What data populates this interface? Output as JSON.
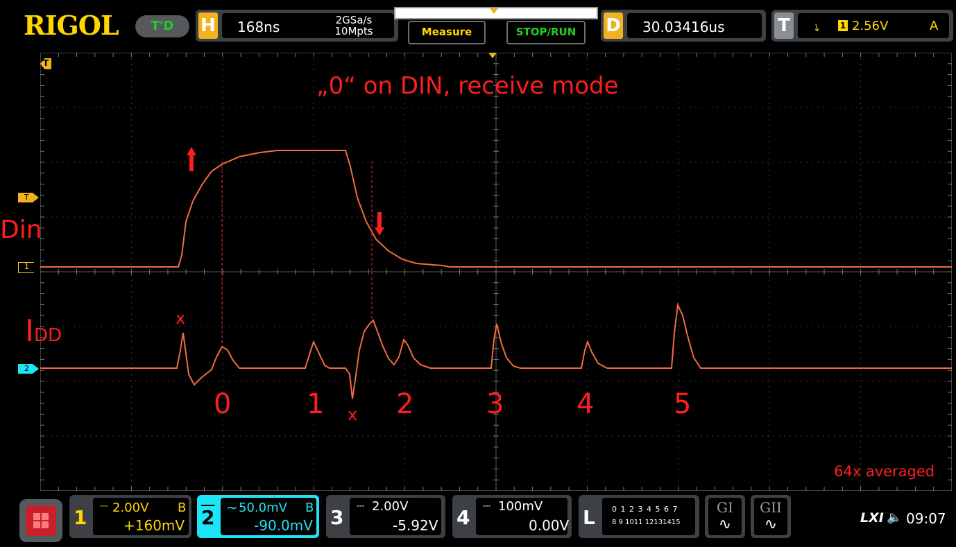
{
  "header": {
    "brand": "RIGOL",
    "trigger_state": "T'D",
    "horizontal": {
      "key": "H",
      "timebase": "168ns",
      "sample_rate": "2GSa/s",
      "memory_depth": "10Mpts"
    },
    "buttons": {
      "measure": "Measure",
      "stop_run": "STOP/RUN"
    },
    "delay": {
      "key": "D",
      "value": "30.03416us"
    },
    "trigger": {
      "key": "T",
      "source_icon": "1",
      "level": "2.56V",
      "mode": "A"
    }
  },
  "screen": {
    "annotations": {
      "title": "„0“ on DIN, receive mode",
      "din_label": "Din",
      "idd_label_main": "I",
      "idd_label_sub": "DD",
      "marker_x1": "x",
      "marker_x2": "x",
      "pulse_numbers": [
        "0",
        "1",
        "2",
        "3",
        "4",
        "5"
      ],
      "averaged": "64x averaged"
    },
    "markers": {
      "ch1": "1",
      "ch2": "2",
      "trigger_level": "T",
      "trigger_pos": "T"
    }
  },
  "channels": [
    {
      "num": "1",
      "coupling_icon": "dc",
      "scale": "2.00V",
      "bw": "B",
      "offset": "+160mV",
      "color": "#ffd700"
    },
    {
      "num": "2",
      "coupling_icon": "ac",
      "scale": "50.0mV",
      "bw": "B",
      "offset": "-90.0mV",
      "color": "#1ee5f5"
    },
    {
      "num": "3",
      "coupling_icon": "dc",
      "scale": "2.00V",
      "bw": "",
      "offset": "-5.92V",
      "color": "#ffffff"
    },
    {
      "num": "4",
      "coupling_icon": "dc",
      "scale": "100mV",
      "bw": "",
      "offset": "0.00V",
      "color": "#ffffff"
    }
  ],
  "logic": {
    "key": "L",
    "row1": "0 1 2 3  4 5 6 7",
    "row2": "8 9 1011 12131415"
  },
  "gen": [
    {
      "label": "GI"
    },
    {
      "label": "GII"
    }
  ],
  "status": {
    "lxi": "LXI",
    "time": "09:07"
  },
  "colors": {
    "ch1": "#ffd700",
    "ch2": "#1ee5f5",
    "annotation": "#ff1e1e",
    "panel": "#3d4145",
    "trace": "#f26d3d"
  }
}
